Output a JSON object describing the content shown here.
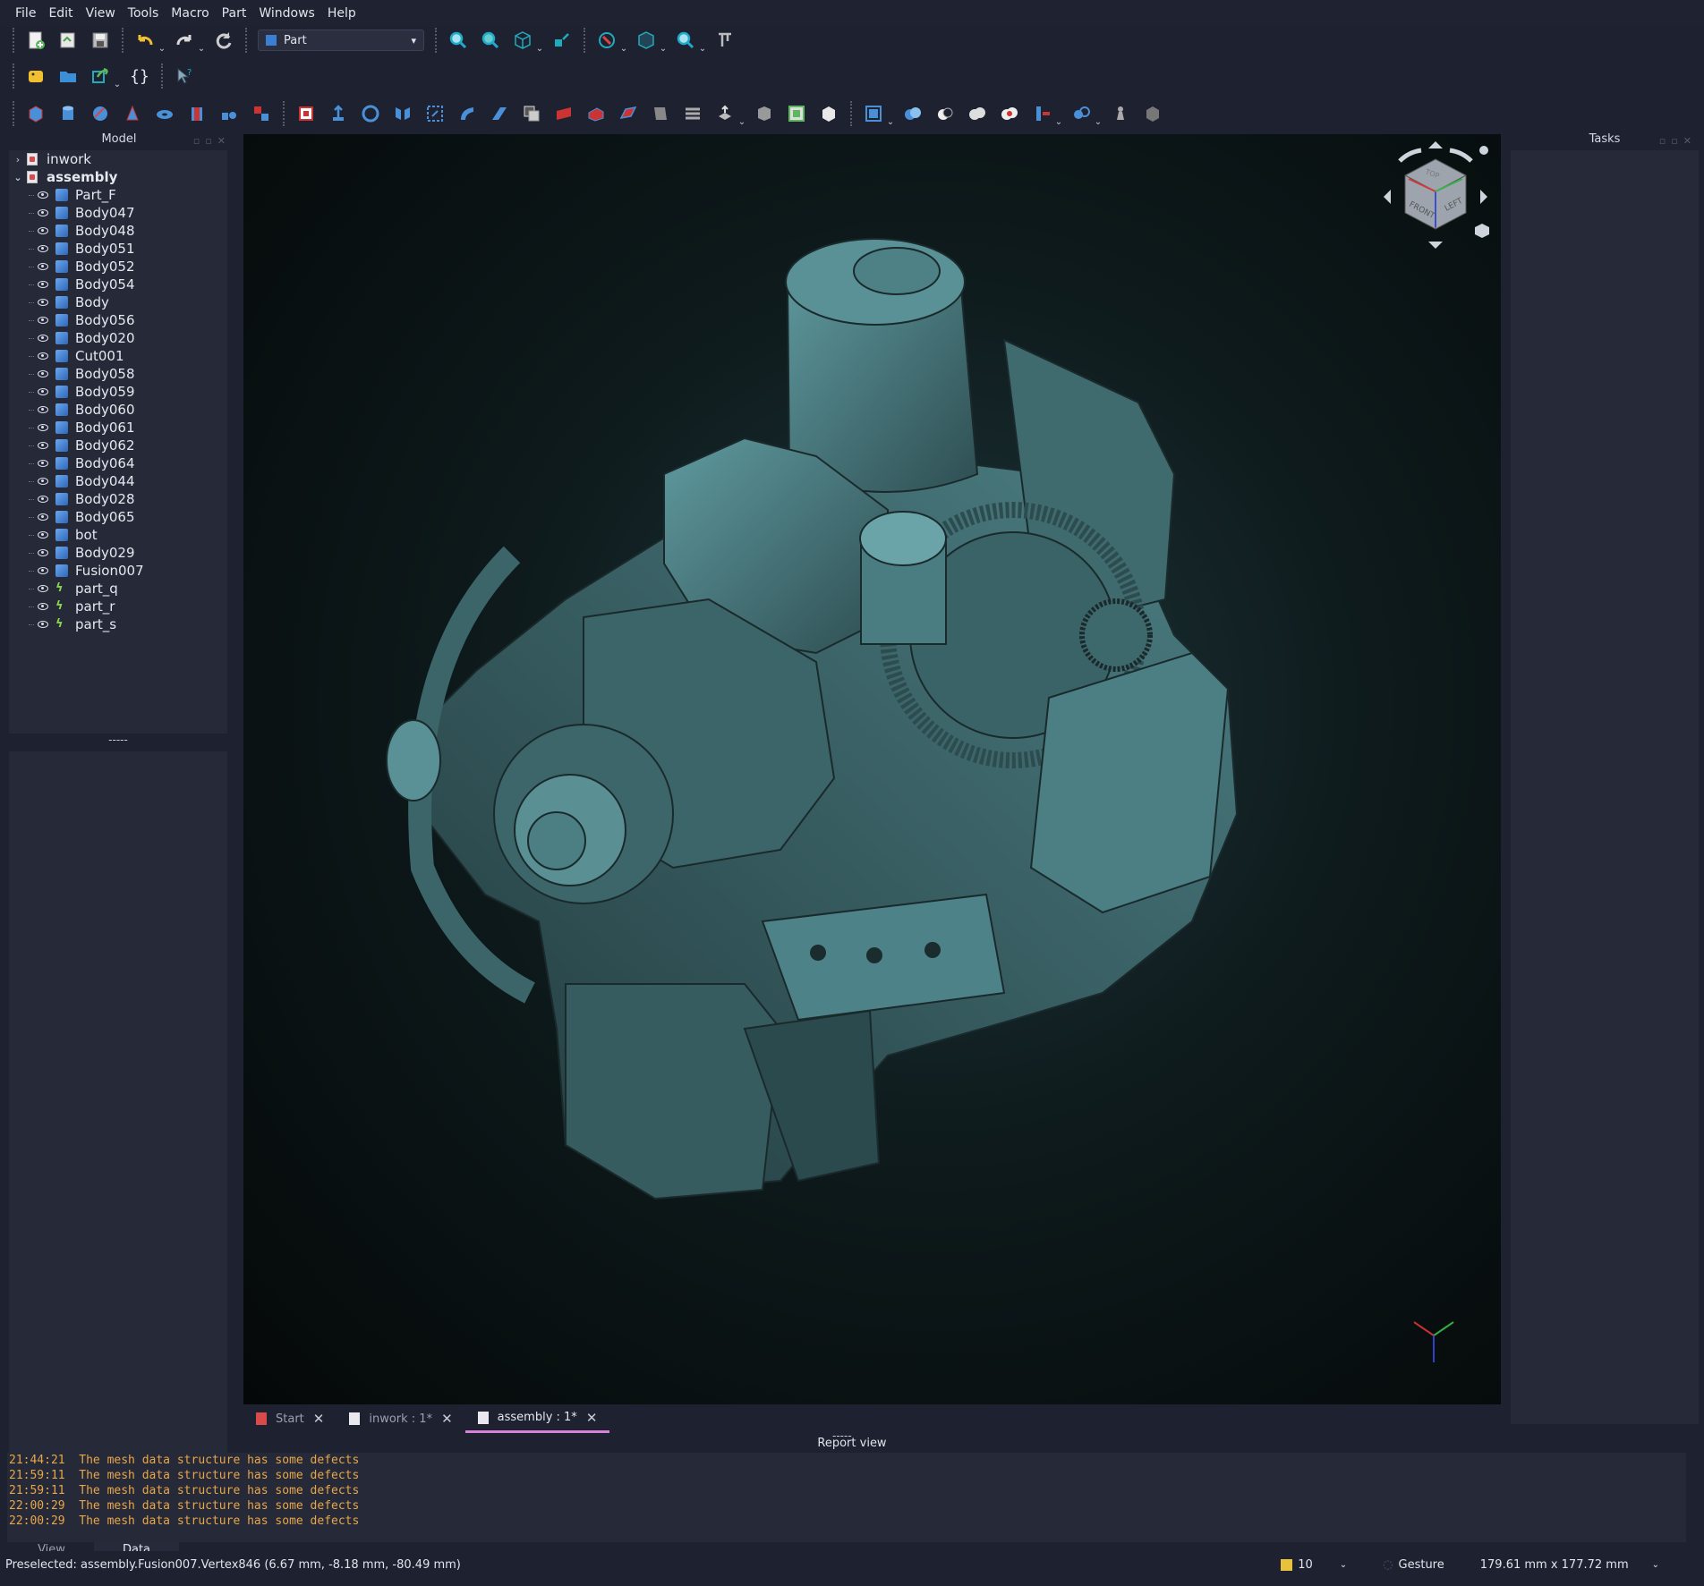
{
  "menu": [
    "File",
    "Edit",
    "View",
    "Tools",
    "Macro",
    "Part",
    "Windows",
    "Help"
  ],
  "toolbar": {
    "workbench": "Part"
  },
  "left_panel": {
    "title": "Model",
    "tree": [
      {
        "label": "inwork",
        "kind": "doc",
        "expanded": false
      },
      {
        "label": "assembly",
        "kind": "doc",
        "expanded": true
      },
      {
        "label": "Part_F",
        "kind": "body"
      },
      {
        "label": "Body047",
        "kind": "body"
      },
      {
        "label": "Body048",
        "kind": "body"
      },
      {
        "label": "Body051",
        "kind": "body"
      },
      {
        "label": "Body052",
        "kind": "body"
      },
      {
        "label": "Body054",
        "kind": "body"
      },
      {
        "label": "Body",
        "kind": "body"
      },
      {
        "label": "Body056",
        "kind": "body"
      },
      {
        "label": "Body020",
        "kind": "body"
      },
      {
        "label": "Cut001",
        "kind": "body"
      },
      {
        "label": "Body058",
        "kind": "body"
      },
      {
        "label": "Body059",
        "kind": "body"
      },
      {
        "label": "Body060",
        "kind": "body"
      },
      {
        "label": "Body061",
        "kind": "body"
      },
      {
        "label": "Body062",
        "kind": "body"
      },
      {
        "label": "Body064",
        "kind": "body"
      },
      {
        "label": "Body044",
        "kind": "body"
      },
      {
        "label": "Body028",
        "kind": "body"
      },
      {
        "label": "Body065",
        "kind": "body"
      },
      {
        "label": "bot",
        "kind": "body"
      },
      {
        "label": "Body029",
        "kind": "body"
      },
      {
        "label": "Fusion007",
        "kind": "body"
      },
      {
        "label": "part_q",
        "kind": "part"
      },
      {
        "label": "part_r",
        "kind": "part"
      },
      {
        "label": "part_s",
        "kind": "part"
      }
    ],
    "splitter": "-----",
    "tabs": [
      "View",
      "Data"
    ],
    "active_tab": "Data"
  },
  "right_panel": {
    "title": "Tasks"
  },
  "navcube": {
    "faces": [
      "FRONT",
      "LEFT",
      "TOP"
    ]
  },
  "doc_tabs": [
    {
      "label": "Start",
      "icon": "freecad-start-icon"
    },
    {
      "label": "inwork : 1*",
      "icon": "document-icon"
    },
    {
      "label": "assembly : 1*",
      "icon": "document-icon",
      "active": true
    }
  ],
  "report": {
    "title": "Report view",
    "splitter": "-----",
    "lines": [
      "21:44:21  The mesh data structure has some defects",
      "21:59:11  The mesh data structure has some defects",
      "21:59:11  The mesh data structure has some defects",
      "22:00:29  The mesh data structure has some defects",
      "22:00:29  The mesh data structure has some defects"
    ]
  },
  "status": {
    "preselected": "Preselected: assembly.Fusion007.Vertex846 (6.67 mm, -8.18 mm, -80.49 mm)",
    "count": "10",
    "nav_style": "Gesture",
    "dimensions": "179.61 mm x 177.72 mm"
  },
  "colors": {
    "accent": "#d881d8",
    "background": "#1e2130",
    "panel": "#252938",
    "report_text": "#e8a64a"
  }
}
